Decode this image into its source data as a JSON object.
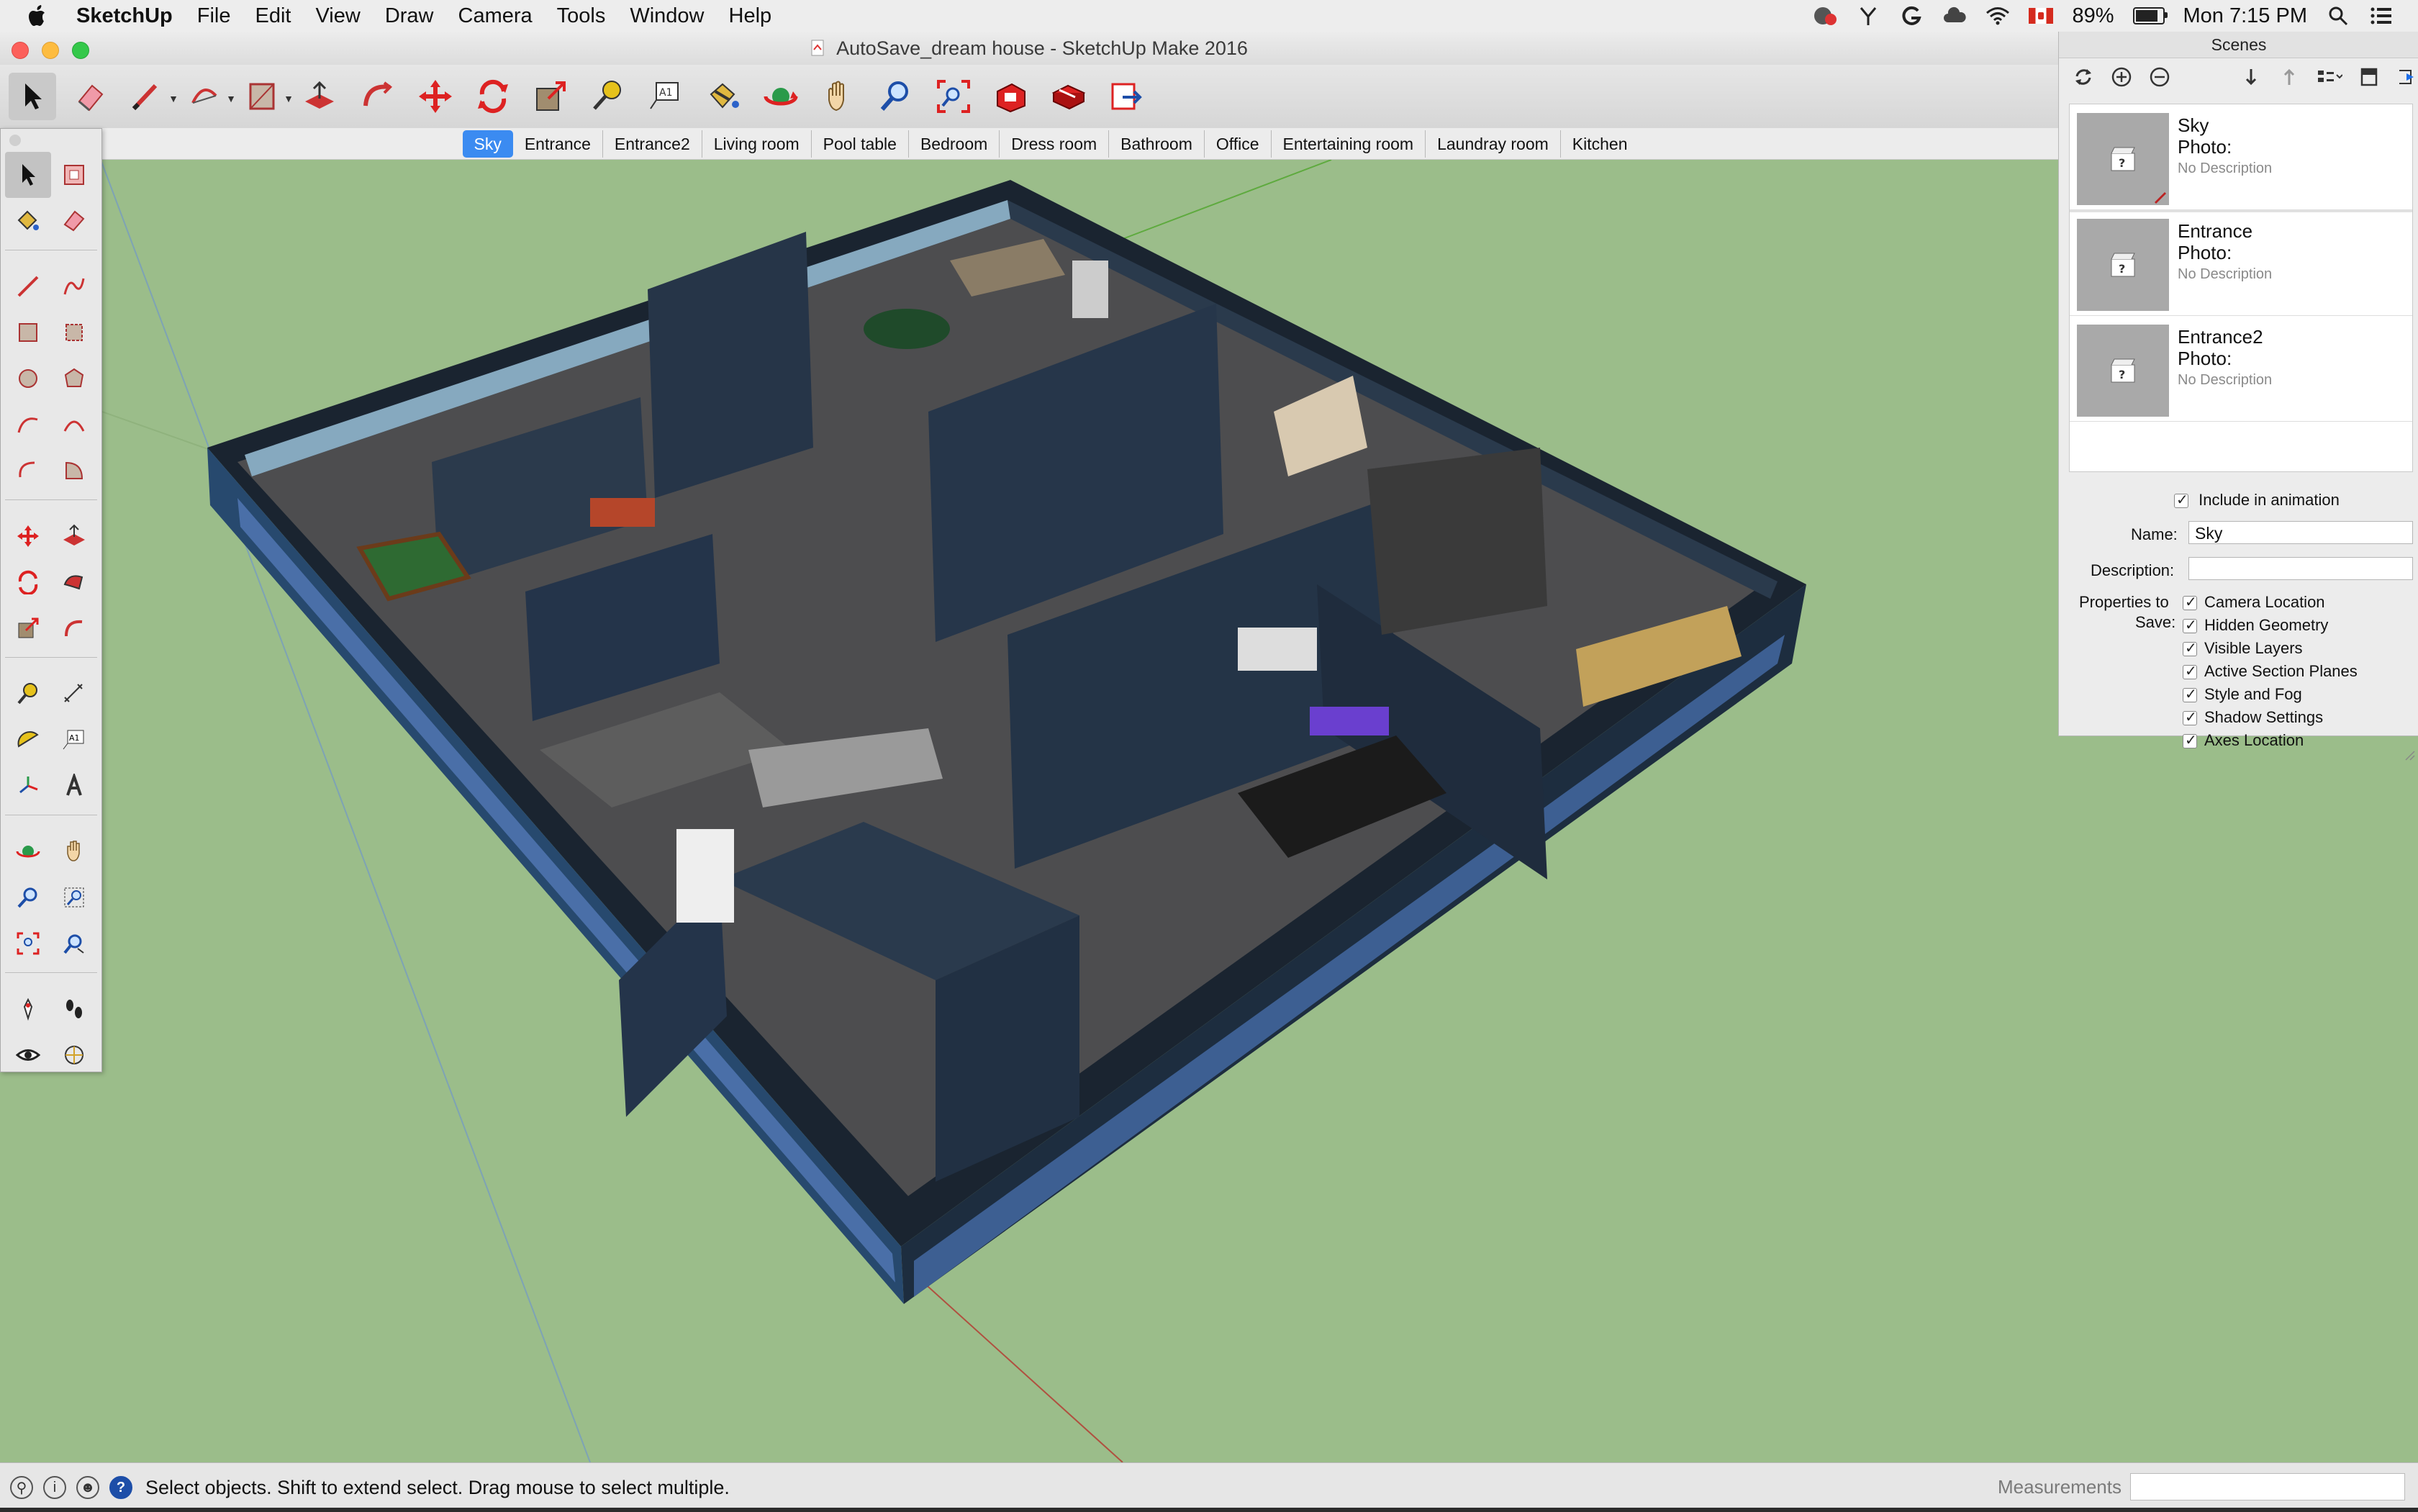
{
  "menubar": {
    "app_name": "SketchUp",
    "items": [
      "File",
      "Edit",
      "View",
      "Draw",
      "Camera",
      "Tools",
      "Window",
      "Help"
    ],
    "battery": "89%",
    "clock": "Mon 7:15 PM"
  },
  "window": {
    "title": "AutoSave_dream house - SketchUp Make 2016"
  },
  "scene_tabs": [
    {
      "label": "Sky",
      "active": true
    },
    {
      "label": "Entrance"
    },
    {
      "label": "Entrance2"
    },
    {
      "label": "Living room"
    },
    {
      "label": "Pool table"
    },
    {
      "label": "Bedroom"
    },
    {
      "label": "Dress room"
    },
    {
      "label": "Bathroom"
    },
    {
      "label": "Office"
    },
    {
      "label": "Entertaining room"
    },
    {
      "label": "Laundray room"
    },
    {
      "label": "Kitchen"
    }
  ],
  "scenes_panel": {
    "title": "Scenes",
    "scenes": [
      {
        "name": "Sky",
        "photo_label": "Photo:",
        "description": "No Description"
      },
      {
        "name": "Entrance",
        "photo_label": "Photo:",
        "description": "No Description"
      },
      {
        "name": "Entrance2",
        "photo_label": "Photo:",
        "description": "No Description"
      }
    ],
    "include_in_animation": "Include in animation",
    "name_label": "Name:",
    "name_value": "Sky",
    "description_label": "Description:",
    "description_value": "",
    "properties_label_1": "Properties to",
    "properties_label_2": "Save:",
    "properties": [
      "Camera Location",
      "Hidden Geometry",
      "Visible Layers",
      "Active Section Planes",
      "Style and Fog",
      "Shadow Settings",
      "Axes Location"
    ]
  },
  "statusbar": {
    "message": "Select objects. Shift to extend select. Drag mouse to select multiple.",
    "measurements_label": "Measurements"
  },
  "colors": {
    "sky_ground": "#9bbd8a",
    "accent": "#3b8bf1",
    "wall_dark": "#1f2a35",
    "floor": "#4a4a4a"
  }
}
